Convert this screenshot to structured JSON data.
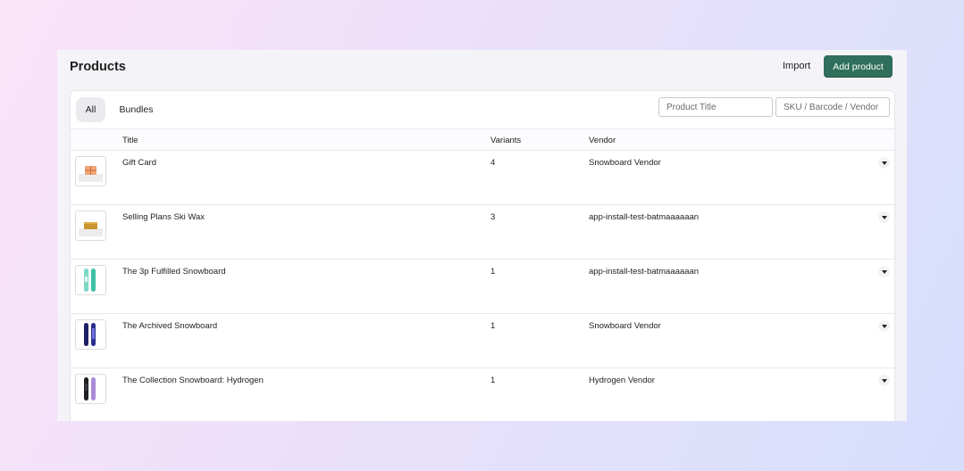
{
  "header": {
    "title": "Products",
    "import_label": "Import",
    "add_label": "Add product",
    "accent_color": "#2f6f5b"
  },
  "tabs": [
    {
      "label": "All",
      "active": true
    },
    {
      "label": "Bundles",
      "active": false
    }
  ],
  "search": {
    "title_placeholder": "Product Title",
    "sku_placeholder": "SKU / Barcode / Vendor"
  },
  "table": {
    "columns": {
      "title": "Title",
      "variants": "Variants",
      "vendor": "Vendor"
    },
    "rows": [
      {
        "title": "Gift Card",
        "variants": "4",
        "vendor": "Snowboard Vendor",
        "icon": "gift-card-thumbnail"
      },
      {
        "title": "Selling Plans Ski Wax",
        "variants": "3",
        "vendor": "app-install-test-batmaaaaaan",
        "icon": "ski-wax-thumbnail"
      },
      {
        "title": "The 3p Fulfilled Snowboard",
        "variants": "1",
        "vendor": "app-install-test-batmaaaaaan",
        "icon": "snowboard-teal-thumbnail"
      },
      {
        "title": "The Archived Snowboard",
        "variants": "1",
        "vendor": "Snowboard Vendor",
        "icon": "snowboard-navy-thumbnail"
      },
      {
        "title": "The Collection Snowboard: Hydrogen",
        "variants": "1",
        "vendor": "Hydrogen Vendor",
        "icon": "snowboard-dark-purple-thumbnail"
      }
    ]
  }
}
